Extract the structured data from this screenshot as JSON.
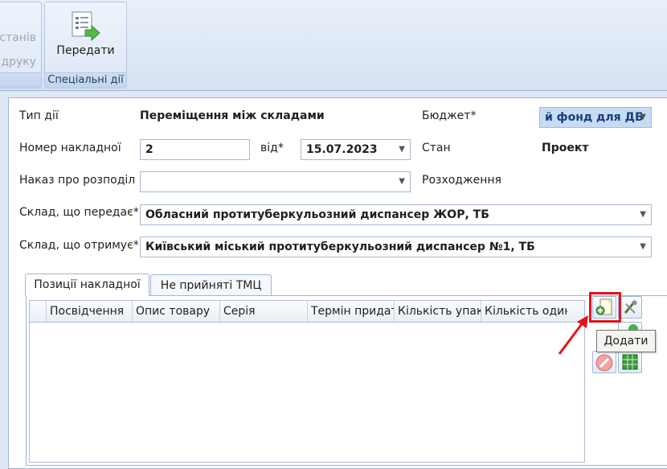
{
  "ribbon": {
    "left_group": {
      "item1": "станів",
      "item2": "друку"
    },
    "special_group": {
      "button_label": "Передати",
      "group_label": "Спеціальні дії"
    }
  },
  "form": {
    "action_type_label": "Тип дії",
    "action_type_value": "Переміщення між складами",
    "budget_label": "Бюджет*",
    "budget_value": "й фонд для ДБ",
    "invoice_number_label": "Номер накладної",
    "invoice_number_value": "2",
    "from_label": "від*",
    "date_value": "15.07.2023",
    "state_label": "Стан",
    "state_value": "Проект",
    "distribution_order_label": "Наказ про розподіл",
    "distribution_order_value": "",
    "divergence_label": "Розходження",
    "warehouse_from_label": "Склад, що передає*",
    "warehouse_from_value": "Обласний протитуберкульозний диспансер ЖОР, ТБ",
    "warehouse_to_label": "Склад, що отримує*",
    "warehouse_to_value": "Київський міський протитуберкульозний диспансер №1, ТБ"
  },
  "tabs": [
    {
      "label": "Позиції накладної",
      "active": true
    },
    {
      "label": "Не прийняті ТМЦ",
      "active": false
    }
  ],
  "grid": {
    "columns": [
      "Посвідчення",
      "Опис товару",
      "Серія",
      "Термін придат",
      "Кількість упак",
      "Кількість один"
    ]
  },
  "tooltip": "Додати",
  "colors": {
    "highlight": "#e3141b",
    "arrow": "#e3141b"
  }
}
